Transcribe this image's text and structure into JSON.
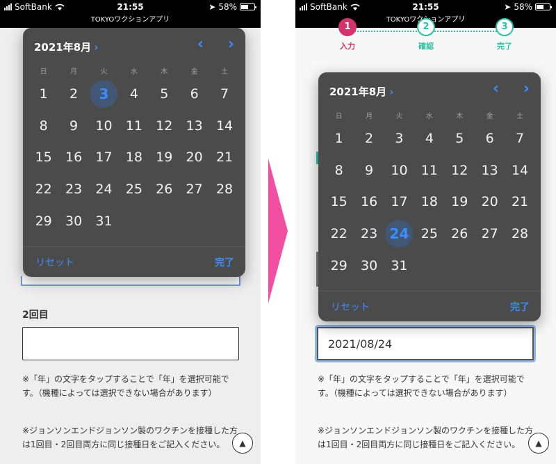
{
  "status_bar": {
    "carrier": "SoftBank",
    "time": "21:55",
    "battery": "58%",
    "battery_level": 0.58
  },
  "app_title": "TOKYOワクションアプリ",
  "colors": {
    "accent": "#3f8cff",
    "picker_bg": "#4b4b4b",
    "step_active": "#d6336c",
    "step_inactive": "#2bbfa5",
    "arrow": "#f04fa2"
  },
  "steps": [
    {
      "number": "1",
      "label": "入力"
    },
    {
      "number": "2",
      "label": "確認"
    },
    {
      "number": "3",
      "label": "完了"
    }
  ],
  "picker": {
    "month": "2021年8月",
    "weekdays": [
      "日",
      "月",
      "火",
      "水",
      "木",
      "金",
      "土"
    ],
    "days": [
      "1",
      "2",
      "3",
      "4",
      "5",
      "6",
      "7",
      "8",
      "9",
      "10",
      "11",
      "12",
      "13",
      "14",
      "15",
      "16",
      "17",
      "18",
      "19",
      "20",
      "21",
      "22",
      "23",
      "24",
      "25",
      "26",
      "27",
      "28",
      "29",
      "30",
      "31"
    ],
    "reset_label": "リセット",
    "done_label": "完了",
    "selected_left": "3",
    "selected_right": "24"
  },
  "form": {
    "second_dose_label": "2回目",
    "second_dose_value": "",
    "entered_date": "2021/08/24",
    "note_year": "※「年」の文字をタップすることで「年」を選択可能です。（機種によっては選択できない場合があります）",
    "note_jj": "※ジョンソンエンドジョンソン製のワクチンを接種した方は1回目・2回目両方に同じ接種日をご記入ください。"
  },
  "icons": {
    "scroll_top": "▲"
  }
}
